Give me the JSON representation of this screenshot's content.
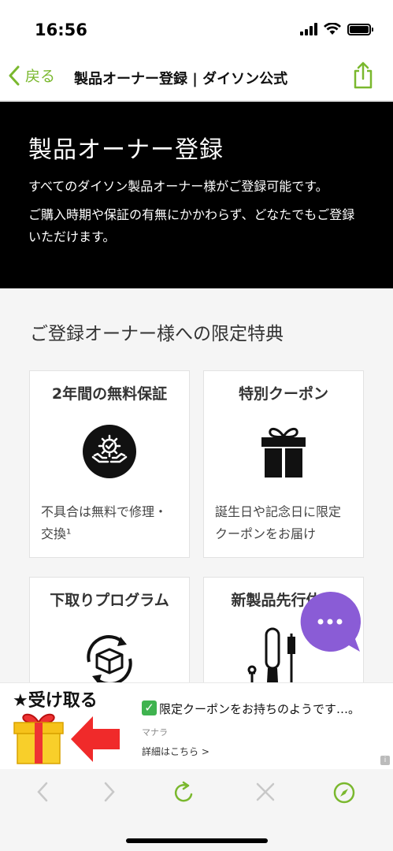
{
  "status": {
    "time": "16:56"
  },
  "nav": {
    "back_label": "戻る",
    "title": "製品オーナー登録 | ダイソン公式"
  },
  "hero": {
    "title": "製品オーナー登録",
    "line1": "すべてのダイソン製品オーナー様がご登録可能です。",
    "line2": "ご購入時期や保証の有無にかかわらず、どなたでもご登録いただけます。"
  },
  "benefits": {
    "section_title": "ご登録オーナー様への限定特典",
    "cards": [
      {
        "title": "2年間の無料保証",
        "desc": "不具合は無料で修理・交換¹",
        "icon": "warranty-hands-gear-icon"
      },
      {
        "title": "特別クーポン",
        "desc": "誕生日や記念日に限定クーポンをお届け",
        "icon": "gift-box-icon"
      },
      {
        "title": "下取りプログラム",
        "desc": "",
        "icon": "box-recycle-icon"
      },
      {
        "title": "新製品先行体験",
        "desc": "",
        "icon": "new-products-icon"
      }
    ]
  },
  "ad": {
    "receive_label": "★受け取る",
    "title": "限定クーポンをお持ちのようです…。",
    "source": "マナラ",
    "link_label": "詳細はこちら >",
    "info": "i"
  },
  "colors": {
    "accent": "#7ab82e",
    "chat": "#8a5cd6",
    "hero_bg": "#000000",
    "content_bg": "#f5f5f5"
  }
}
